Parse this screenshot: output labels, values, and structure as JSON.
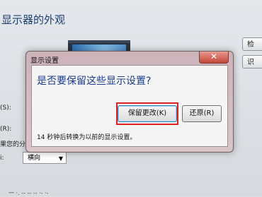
{
  "background": {
    "title": "显示器的外观",
    "side_buttons": [
      "检",
      "识"
    ],
    "labels": [
      "(S):",
      "(R):",
      "果您的分",
      "i:"
    ],
    "orientation_value": "横向",
    "footer": "一 ·. -- -- -- ·- ·-"
  },
  "dialog": {
    "title": "显示设置",
    "close_glyph": "✕",
    "message": "是否要保留这些显示设置?",
    "keep_button": "保留更改(K)",
    "revert_button": "还原(R)",
    "countdown": "14 秒钟后转换为以前的显示设置。"
  }
}
